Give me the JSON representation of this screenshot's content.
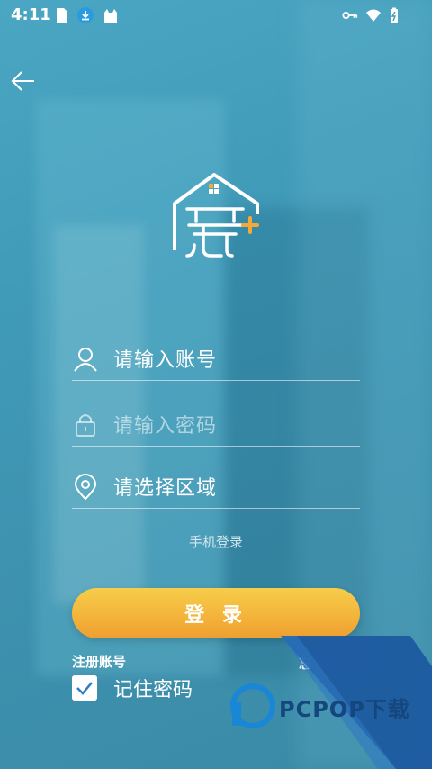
{
  "status_bar": {
    "time": "4:11",
    "left_icons": [
      "sim-icon",
      "download-icon",
      "cat-icon"
    ],
    "right_icons": [
      "key-icon",
      "wifi-icon",
      "battery-icon"
    ]
  },
  "back_icon": "arrow-left-icon",
  "logo": {
    "glyph": "寓",
    "plus": "+"
  },
  "form": {
    "username": {
      "value": "请输入账号",
      "icon": "user-icon"
    },
    "password": {
      "placeholder": "请输入密码",
      "icon": "lock-icon"
    },
    "region": {
      "value": "请选择区域",
      "icon": "location-pin-icon"
    }
  },
  "phone_login_label": "手机登录",
  "login_button_label": "登 录",
  "register_label": "注册账号",
  "forgot_label": "忘",
  "remember": {
    "label": "记住密码",
    "checked": true
  },
  "watermark": {
    "text": "PCPOP下载"
  },
  "colors": {
    "accent_yellow": "#f3b23a",
    "background_blue": "#3f9ab8",
    "watermark_blue": "#16467e"
  }
}
